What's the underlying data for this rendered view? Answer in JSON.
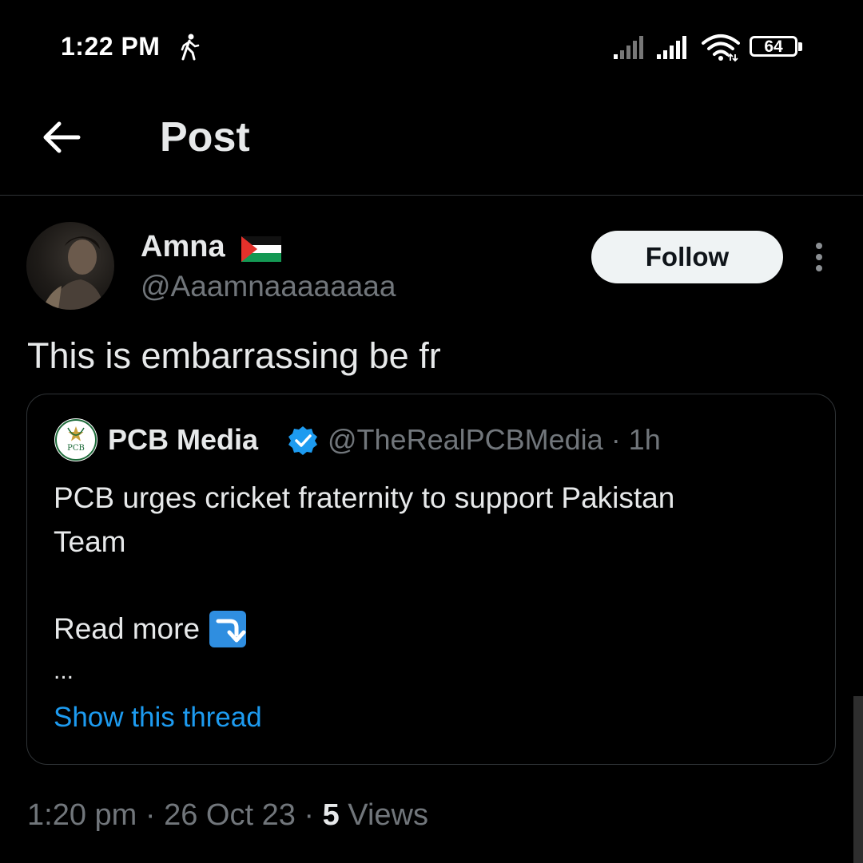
{
  "status_bar": {
    "time": "1:22 PM",
    "battery_level": "64"
  },
  "header": {
    "title": "Post"
  },
  "post": {
    "author_name": "Amna",
    "author_handle": "@Aaamnaaaaaaaa",
    "follow_label": "Follow",
    "text": "This is embarrassing be fr",
    "timestamp": "1:20 pm · 26 Oct 23 · ",
    "views_count": "5",
    "views_label": " Views"
  },
  "quote": {
    "name": "PCB Media",
    "handle_time": "@TheRealPCBMedia · 1h",
    "line1": "PCB urges cricket fraternity to support Pakistan",
    "line2": "Team",
    "read_more": "Read more",
    "ellipsis": "...",
    "show_thread": "Show this thread",
    "logo_text": "PCB"
  },
  "colors": {
    "background": "#000000",
    "text_primary": "#e7e9ea",
    "text_secondary": "#71767b",
    "accent": "#1d9bf0",
    "verified": "#1d9bf0",
    "border": "#2f3336"
  },
  "icons": {
    "walk": "walking-person-icon",
    "signal": "cell-signal-icon",
    "wifi": "wifi-icon",
    "battery": "battery-icon",
    "back": "back-arrow-icon",
    "flag": "palestine-flag-icon",
    "more": "more-vertical-icon",
    "verified": "verified-badge-icon",
    "arrow_emoji": "right-arrow-curving-down-icon"
  }
}
